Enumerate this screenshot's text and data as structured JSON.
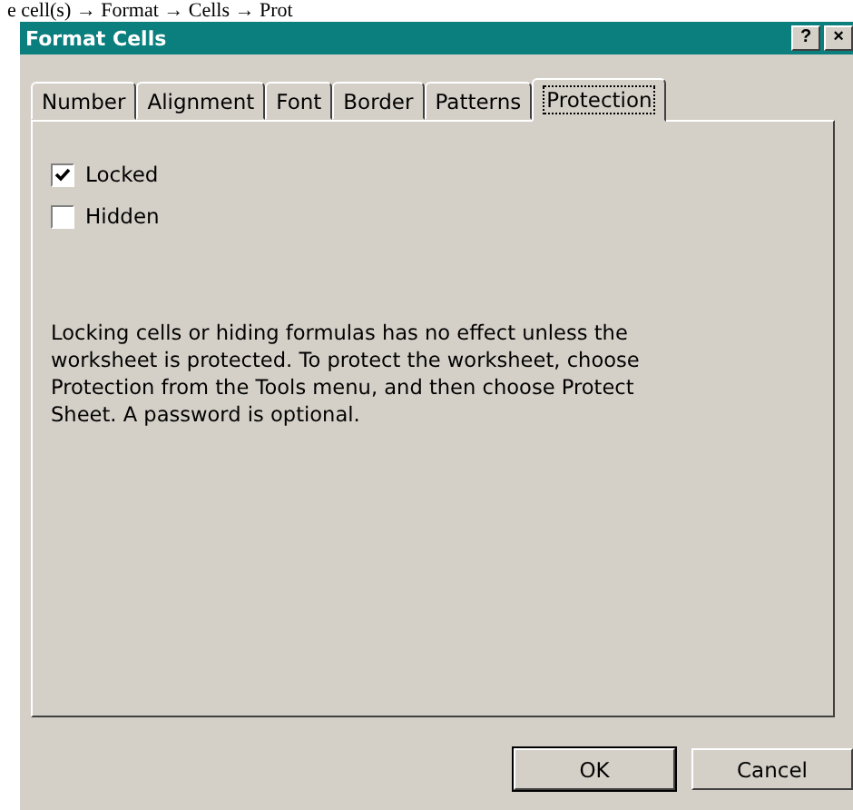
{
  "document_text": "e cell(s) → Format → Cells → Prot",
  "window": {
    "title": "Format Cells",
    "title_buttons": [
      "?",
      "×"
    ]
  },
  "tabs": [
    {
      "label": "Number",
      "selected": false
    },
    {
      "label": "Alignment",
      "selected": false
    },
    {
      "label": "Font",
      "selected": false
    },
    {
      "label": "Border",
      "selected": false
    },
    {
      "label": "Patterns",
      "selected": false
    },
    {
      "label": "Protection",
      "selected": true
    }
  ],
  "options": [
    {
      "label": "Locked",
      "checked": true
    },
    {
      "label": "Hidden",
      "checked": false
    }
  ],
  "note": "Locking cells or hiding formulas has no effect unless the worksheet is protected. To protect the worksheet, choose Protection from the Tools menu, and then choose Protect Sheet. A password is optional.",
  "buttons": [
    {
      "label": "OK",
      "default": true
    },
    {
      "label": "Cancel",
      "default": false
    }
  ]
}
